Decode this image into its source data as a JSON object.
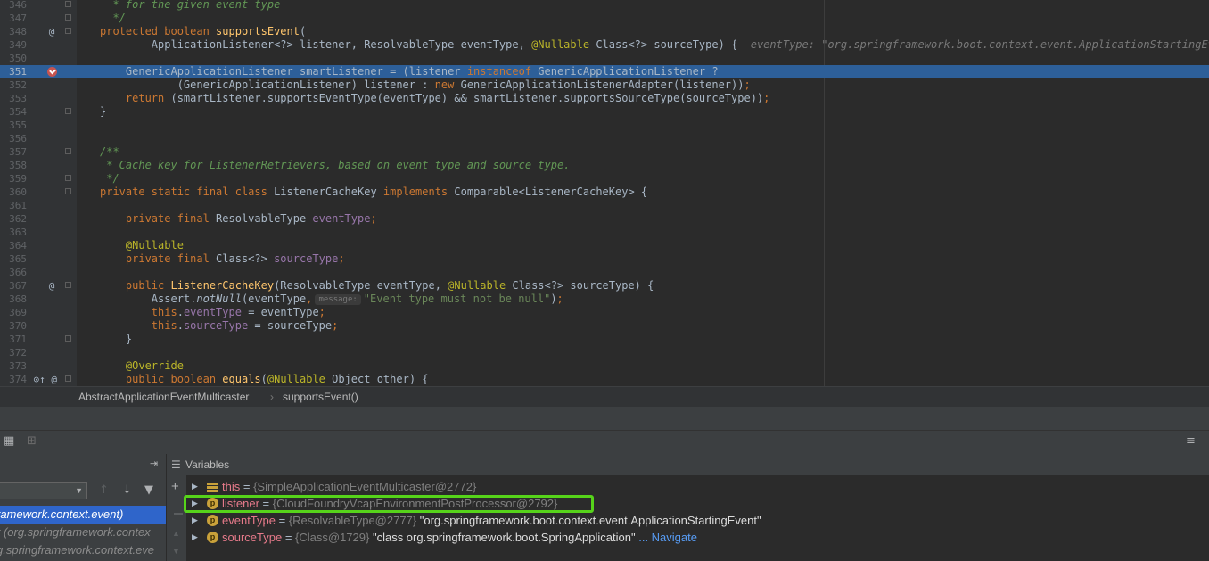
{
  "editor": {
    "lines": [
      {
        "num": "346",
        "mark": "",
        "tokens": [
          [
            "doc",
            "  * for the given event type"
          ]
        ]
      },
      {
        "num": "347",
        "mark": "",
        "tokens": [
          [
            "doc",
            "  */"
          ]
        ]
      },
      {
        "num": "348",
        "mark": "@",
        "tokens": [
          [
            "k",
            "protected boolean "
          ],
          [
            "f",
            "supportsEvent"
          ],
          [
            "p",
            "("
          ]
        ]
      },
      {
        "num": "349",
        "mark": "",
        "tokens": [
          [
            "p",
            "        ApplicationListener<?> listener, ResolvableType eventType, "
          ],
          [
            "ann",
            "@Nullable"
          ],
          [
            "p",
            " Class<?> sourceType) {  "
          ],
          [
            "hint",
            "eventType: \"org.springframework.boot.context.event.ApplicationStartingEvent\""
          ]
        ]
      },
      {
        "num": "350",
        "mark": "",
        "tokens": []
      },
      {
        "num": "351",
        "mark": "bp",
        "hl": true,
        "tokens": [
          [
            "p",
            "    GenericApplicationListener smartListener = (listener "
          ],
          [
            "k",
            "instanceof"
          ],
          [
            "p",
            " GenericApplicationListener ?"
          ]
        ]
      },
      {
        "num": "352",
        "mark": "",
        "tokens": [
          [
            "p",
            "            (GenericApplicationListener) listener : "
          ],
          [
            "k",
            "new"
          ],
          [
            "p",
            " GenericApplicationListenerAdapter(listener))"
          ],
          [
            "k",
            ";"
          ]
        ]
      },
      {
        "num": "353",
        "mark": "",
        "tokens": [
          [
            "k",
            "    return"
          ],
          [
            "p",
            " (smartListener.supportsEventType(eventType) && smartListener.supportsSourceType(sourceType))"
          ],
          [
            "k",
            ";"
          ]
        ]
      },
      {
        "num": "354",
        "mark": "",
        "tokens": [
          [
            "p",
            "}"
          ]
        ]
      },
      {
        "num": "355",
        "mark": "",
        "tokens": []
      },
      {
        "num": "356",
        "mark": "",
        "tokens": []
      },
      {
        "num": "357",
        "mark": "",
        "tokens": [
          [
            "doc",
            "/**"
          ]
        ]
      },
      {
        "num": "358",
        "mark": "",
        "tokens": [
          [
            "doc",
            " * Cache key for ListenerRetrievers, based on event type and source type."
          ]
        ]
      },
      {
        "num": "359",
        "mark": "",
        "tokens": [
          [
            "doc",
            " */"
          ]
        ]
      },
      {
        "num": "360",
        "mark": "",
        "tokens": [
          [
            "k",
            "private static final class "
          ],
          [
            "p",
            "ListenerCacheKey "
          ],
          [
            "k",
            "implements "
          ],
          [
            "p",
            "Comparable<ListenerCacheKey> {"
          ]
        ]
      },
      {
        "num": "361",
        "mark": "",
        "tokens": []
      },
      {
        "num": "362",
        "mark": "",
        "tokens": [
          [
            "k",
            "    private final "
          ],
          [
            "p",
            "ResolvableType "
          ],
          [
            "fld",
            "eventType"
          ],
          [
            "k",
            ";"
          ]
        ]
      },
      {
        "num": "363",
        "mark": "",
        "tokens": []
      },
      {
        "num": "364",
        "mark": "",
        "tokens": [
          [
            "ann",
            "    @Nullable"
          ]
        ]
      },
      {
        "num": "365",
        "mark": "",
        "tokens": [
          [
            "k",
            "    private final "
          ],
          [
            "p",
            "Class<?> "
          ],
          [
            "fld",
            "sourceType"
          ],
          [
            "k",
            ";"
          ]
        ]
      },
      {
        "num": "366",
        "mark": "",
        "tokens": []
      },
      {
        "num": "367",
        "mark": "@",
        "tokens": [
          [
            "k",
            "    public "
          ],
          [
            "f",
            "ListenerCacheKey"
          ],
          [
            "p",
            "(ResolvableType eventType, "
          ],
          [
            "ann",
            "@Nullable"
          ],
          [
            "p",
            " Class<?> sourceType) {"
          ]
        ]
      },
      {
        "num": "368",
        "mark": "",
        "tokens": [
          [
            "p",
            "        Assert."
          ],
          [
            "it",
            "notNull"
          ],
          [
            "p",
            "(eventType"
          ],
          [
            "k",
            ","
          ],
          [
            "phint",
            "message:"
          ],
          [
            "s",
            "\"Event type must not be null\""
          ],
          [
            "p",
            ")"
          ],
          [
            "k",
            ";"
          ]
        ]
      },
      {
        "num": "369",
        "mark": "",
        "tokens": [
          [
            "k",
            "        this"
          ],
          [
            "p",
            "."
          ],
          [
            "fld",
            "eventType"
          ],
          [
            "p",
            " = eventType"
          ],
          [
            "k",
            ";"
          ]
        ]
      },
      {
        "num": "370",
        "mark": "",
        "tokens": [
          [
            "k",
            "        this"
          ],
          [
            "p",
            "."
          ],
          [
            "fld",
            "sourceType"
          ],
          [
            "p",
            " = sourceType"
          ],
          [
            "k",
            ";"
          ]
        ]
      },
      {
        "num": "371",
        "mark": "",
        "tokens": [
          [
            "p",
            "    }"
          ]
        ]
      },
      {
        "num": "372",
        "mark": "",
        "tokens": []
      },
      {
        "num": "373",
        "mark": "",
        "tokens": [
          [
            "ann",
            "    @Override"
          ]
        ]
      },
      {
        "num": "374",
        "mark": "o@",
        "tokens": [
          [
            "k",
            "    public boolean "
          ],
          [
            "f",
            "equals"
          ],
          [
            "p",
            "("
          ],
          [
            "ann",
            "@Nullable"
          ],
          [
            "p",
            " Object other) {"
          ]
        ]
      }
    ]
  },
  "breadcrumb": {
    "class_name": "AbstractApplicationEventMulticaster",
    "separator": "›",
    "method_name": "supportsEvent()"
  },
  "frames": {
    "items": [
      {
        "label": "ramework.context.event)",
        "selected": true
      },
      {
        "label": "r (org.springframework.contex",
        "selected": false
      },
      {
        "label": "g.springframework.context.eve",
        "selected": false
      }
    ]
  },
  "variables": {
    "title": "Variables",
    "rows": [
      {
        "icon": "stack",
        "name": "this",
        "eq": " = ",
        "type": "{SimpleApplicationEventMulticaster@2772}",
        "value": "",
        "link": ""
      },
      {
        "icon": "p",
        "name": "listener",
        "eq": " = ",
        "type": "{CloudFoundryVcapEnvironmentPostProcessor@2792}",
        "value": "",
        "link": ""
      },
      {
        "icon": "p",
        "name": "eventType",
        "eq": " = ",
        "type": "{ResolvableType@2777}",
        "value": " \"org.springframework.boot.context.event.ApplicationStartingEvent\"",
        "link": ""
      },
      {
        "icon": "p",
        "name": "sourceType",
        "eq": " = ",
        "type": "{Class@1729}",
        "value": " \"class org.springframework.boot.SpringApplication\"",
        "link": " ... Navigate"
      }
    ]
  },
  "colors": {
    "accent_selection": "#2f65ca",
    "current_line": "#2d5f99",
    "highlight_box": "#56d31a",
    "breakpoint": "#c75450"
  }
}
